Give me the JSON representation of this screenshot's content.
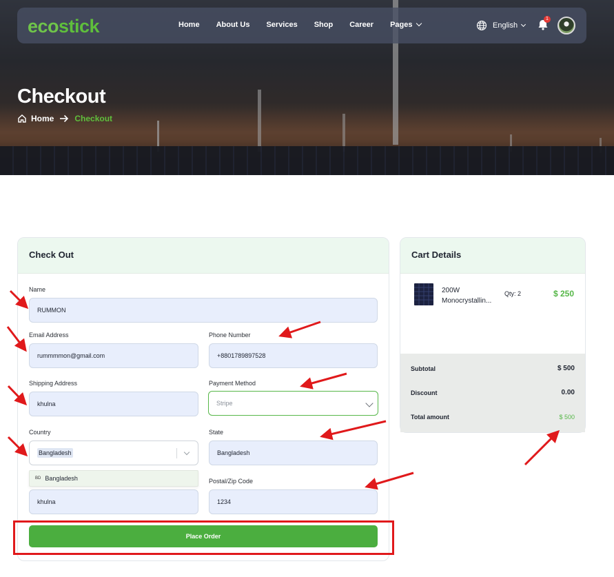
{
  "brand": {
    "logo_part1": "eco",
    "logo_part2": "stick"
  },
  "nav": {
    "items": [
      {
        "label": "Home"
      },
      {
        "label": "About Us"
      },
      {
        "label": "Services"
      },
      {
        "label": "Shop"
      },
      {
        "label": "Career"
      },
      {
        "label": "Pages"
      }
    ],
    "language": "English",
    "notification_count": "1"
  },
  "hero": {
    "title": "Checkout",
    "breadcrumb": {
      "home": "Home",
      "current": "Checkout"
    }
  },
  "checkout": {
    "heading": "Check Out",
    "fields": {
      "name": {
        "label": "Name",
        "value": "RUMMON"
      },
      "email": {
        "label": "Email Address",
        "value": "rummmmon@gmail.com"
      },
      "phone": {
        "label": "Phone Number",
        "value": "+8801789897528"
      },
      "shipping": {
        "label": "Shipping Address",
        "value": "khulna"
      },
      "payment": {
        "label": "Payment Method",
        "value": "Stripe"
      },
      "country": {
        "label": "Country",
        "value": "Bangladesh"
      },
      "state": {
        "label": "State",
        "value": "Bangladesh"
      },
      "city": {
        "value": "khulna"
      },
      "postal": {
        "label": "Postal/Zip Code",
        "value": "1234"
      }
    },
    "country_dropdown": {
      "code": "BD",
      "option": "Bangladesh"
    },
    "place_order": "Place Order"
  },
  "cart": {
    "heading": "Cart Details",
    "item": {
      "name_line1": "200W",
      "name_line2": "Monocrystallin...",
      "qty": "Qty: 2",
      "price": "$ 250"
    },
    "subtotal": {
      "label": "Subtotal",
      "value": "$ 500"
    },
    "discount": {
      "label": "Discount",
      "value": "0.00"
    },
    "total": {
      "label": "Total amount",
      "value": "$ 500"
    }
  },
  "colors": {
    "accent": "#4bae3f",
    "annotation": "#e0191b",
    "header_tint": "#ecf8ef"
  }
}
